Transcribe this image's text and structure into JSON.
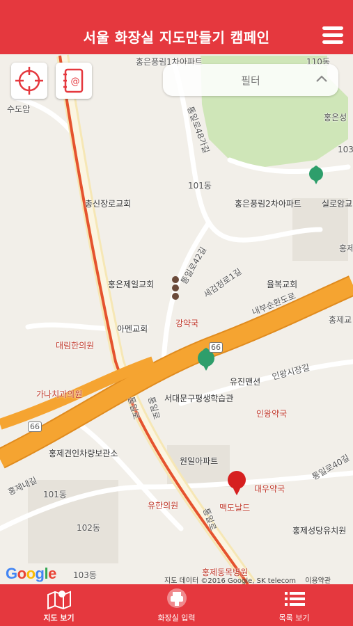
{
  "header": {
    "title": "서울 화장실 지도만들기 캠페인"
  },
  "filter": {
    "label": "필터"
  },
  "map": {
    "street_labels": [
      {
        "text": "홍은풍림1차아파트"
      },
      {
        "text": "110동"
      },
      {
        "text": "수도암"
      },
      {
        "text": "통일로48가길"
      },
      {
        "text": "홍은성"
      },
      {
        "text": "103"
      },
      {
        "text": "101동"
      },
      {
        "text": "총신장로교회"
      },
      {
        "text": "홍은풍림2차아파트"
      },
      {
        "text": "실로암교"
      },
      {
        "text": "통일로42길"
      },
      {
        "text": "세검정로1길"
      },
      {
        "text": "홍은제일교회"
      },
      {
        "text": "율복교회"
      },
      {
        "text": "홍제"
      },
      {
        "text": "강약국"
      },
      {
        "text": "아멘교회"
      },
      {
        "text": "내부순환도로"
      },
      {
        "text": "홍제교"
      },
      {
        "text": "대림한의원"
      },
      {
        "text": "66"
      },
      {
        "text": "유진맨션"
      },
      {
        "text": "인왕시장길"
      },
      {
        "text": "가나치과의원"
      },
      {
        "text": "서대문구평생학습관"
      },
      {
        "text": "인왕약국"
      },
      {
        "text": "66"
      },
      {
        "text": "통일로"
      },
      {
        "text": "통일로"
      },
      {
        "text": "홍제견인차량보관소"
      },
      {
        "text": "원일아파트"
      },
      {
        "text": "통일로40길"
      },
      {
        "text": "홍제내길"
      },
      {
        "text": "대우약국"
      },
      {
        "text": "101동"
      },
      {
        "text": "유한의원"
      },
      {
        "text": "맥도날드"
      },
      {
        "text": "102동"
      },
      {
        "text": "통일로"
      },
      {
        "text": "홍제성당유치원"
      },
      {
        "text": "103동"
      },
      {
        "text": "홍제동목병원"
      }
    ],
    "google_logo": {
      "text": "Google"
    },
    "attribution": "지도 데이터 ©2016 Google, SK telecom",
    "terms": "이용약관"
  },
  "tabs": [
    {
      "label": "지도 보기",
      "icon": "map-icon",
      "active": true
    },
    {
      "label": "화장실 입력",
      "icon": "add-toilet-icon",
      "active": false
    },
    {
      "label": "목록 보기",
      "icon": "list-icon",
      "active": false
    }
  ],
  "colors": {
    "brand": "#e5383e",
    "highway": "#f5a431",
    "subway": "#e5532e",
    "park": "#c8e3b0"
  }
}
